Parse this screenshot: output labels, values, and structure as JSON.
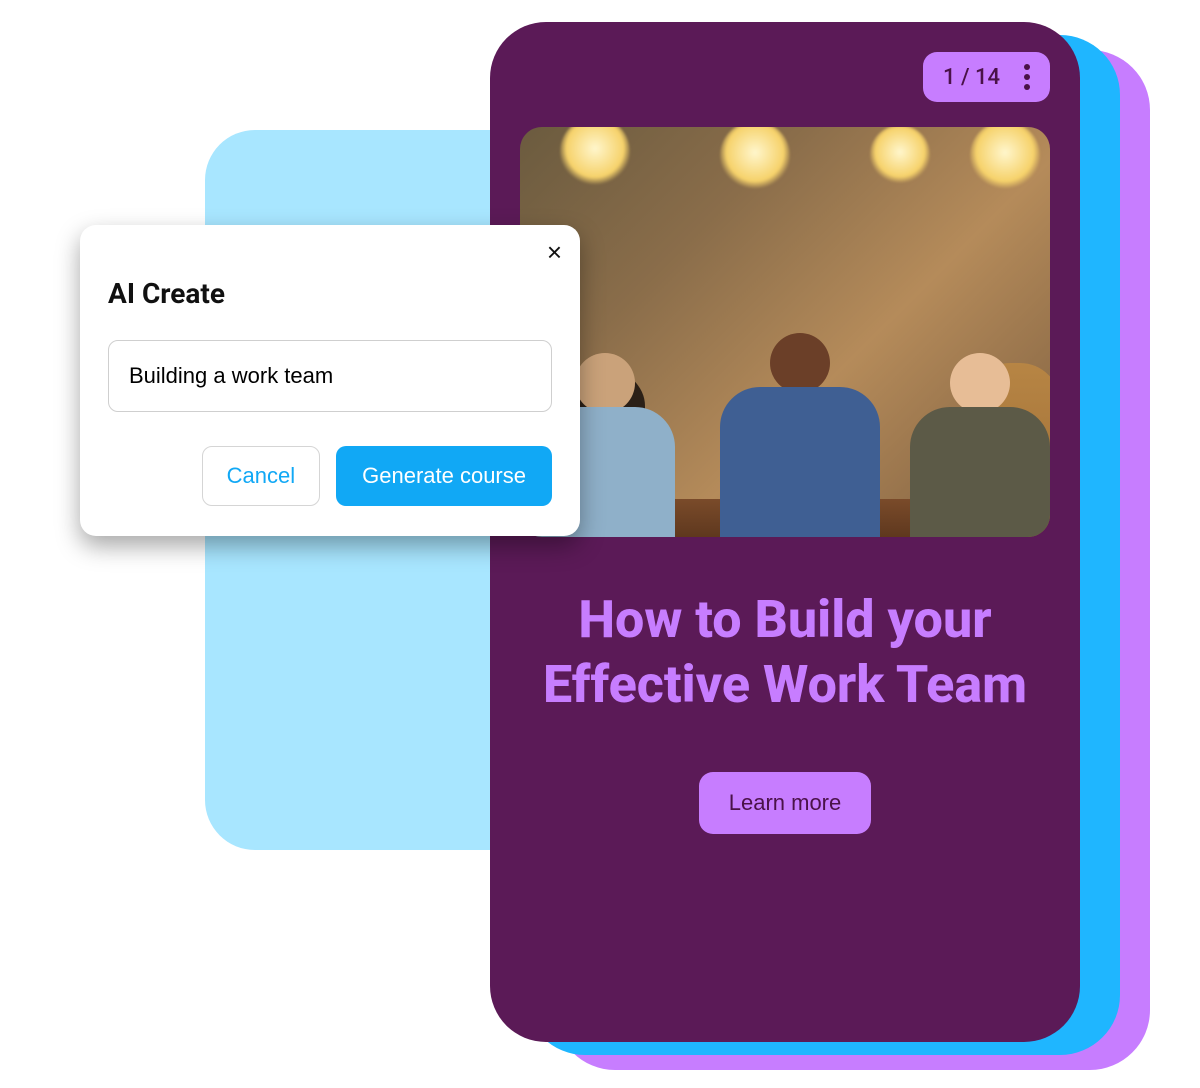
{
  "modal": {
    "title": "AI Create",
    "input_value": "Building a work team",
    "cancel_label": "Cancel",
    "generate_label": "Generate course"
  },
  "course": {
    "page_indicator": "1 / 14",
    "title": "How to Build your Effective Work Team",
    "cta_label": "Learn more"
  },
  "colors": {
    "accent_purple": "#c77dff",
    "deep_purple": "#5b1a57",
    "bright_blue": "#1fb6ff",
    "light_blue": "#a8e6ff",
    "action_blue": "#11a8f5"
  }
}
